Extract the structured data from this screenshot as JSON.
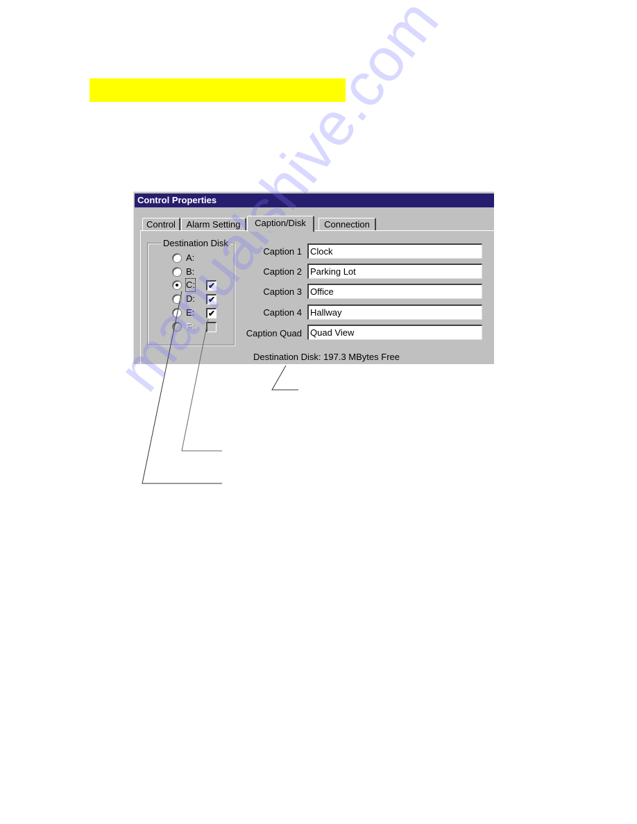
{
  "highlight": {
    "color": "#ffff00"
  },
  "dialog": {
    "title": "Control Properties",
    "tabs": [
      {
        "label": "Control",
        "active": false
      },
      {
        "label": "Alarm Setting",
        "active": false
      },
      {
        "label": "Caption/Disk",
        "active": true
      },
      {
        "label": "Connection",
        "active": false
      }
    ],
    "destination_disk": {
      "group_label": "Destination Disk",
      "drives": [
        {
          "label": "A:",
          "selected": false,
          "checkbox": null,
          "enabled": true
        },
        {
          "label": "B:",
          "selected": false,
          "checkbox": null,
          "enabled": true
        },
        {
          "label": "C:",
          "selected": true,
          "checkbox": true,
          "enabled": true
        },
        {
          "label": "D:",
          "selected": false,
          "checkbox": true,
          "enabled": true
        },
        {
          "label": "E:",
          "selected": false,
          "checkbox": true,
          "enabled": true
        },
        {
          "label": "F:",
          "selected": false,
          "checkbox": false,
          "enabled": false
        }
      ]
    },
    "captions": [
      {
        "label": "Caption 1",
        "value": "Clock"
      },
      {
        "label": "Caption 2",
        "value": "Parking Lot"
      },
      {
        "label": "Caption 3",
        "value": "Office"
      },
      {
        "label": "Caption 4",
        "value": "Hallway"
      },
      {
        "label": "Caption Quad",
        "value": "Quad View"
      }
    ],
    "status": "Destination Disk: 197.3 MBytes Free"
  },
  "watermark": "manualshive.com",
  "colors": {
    "titlebar": "#271d6e",
    "dialog_bg": "#c0c0c0"
  }
}
